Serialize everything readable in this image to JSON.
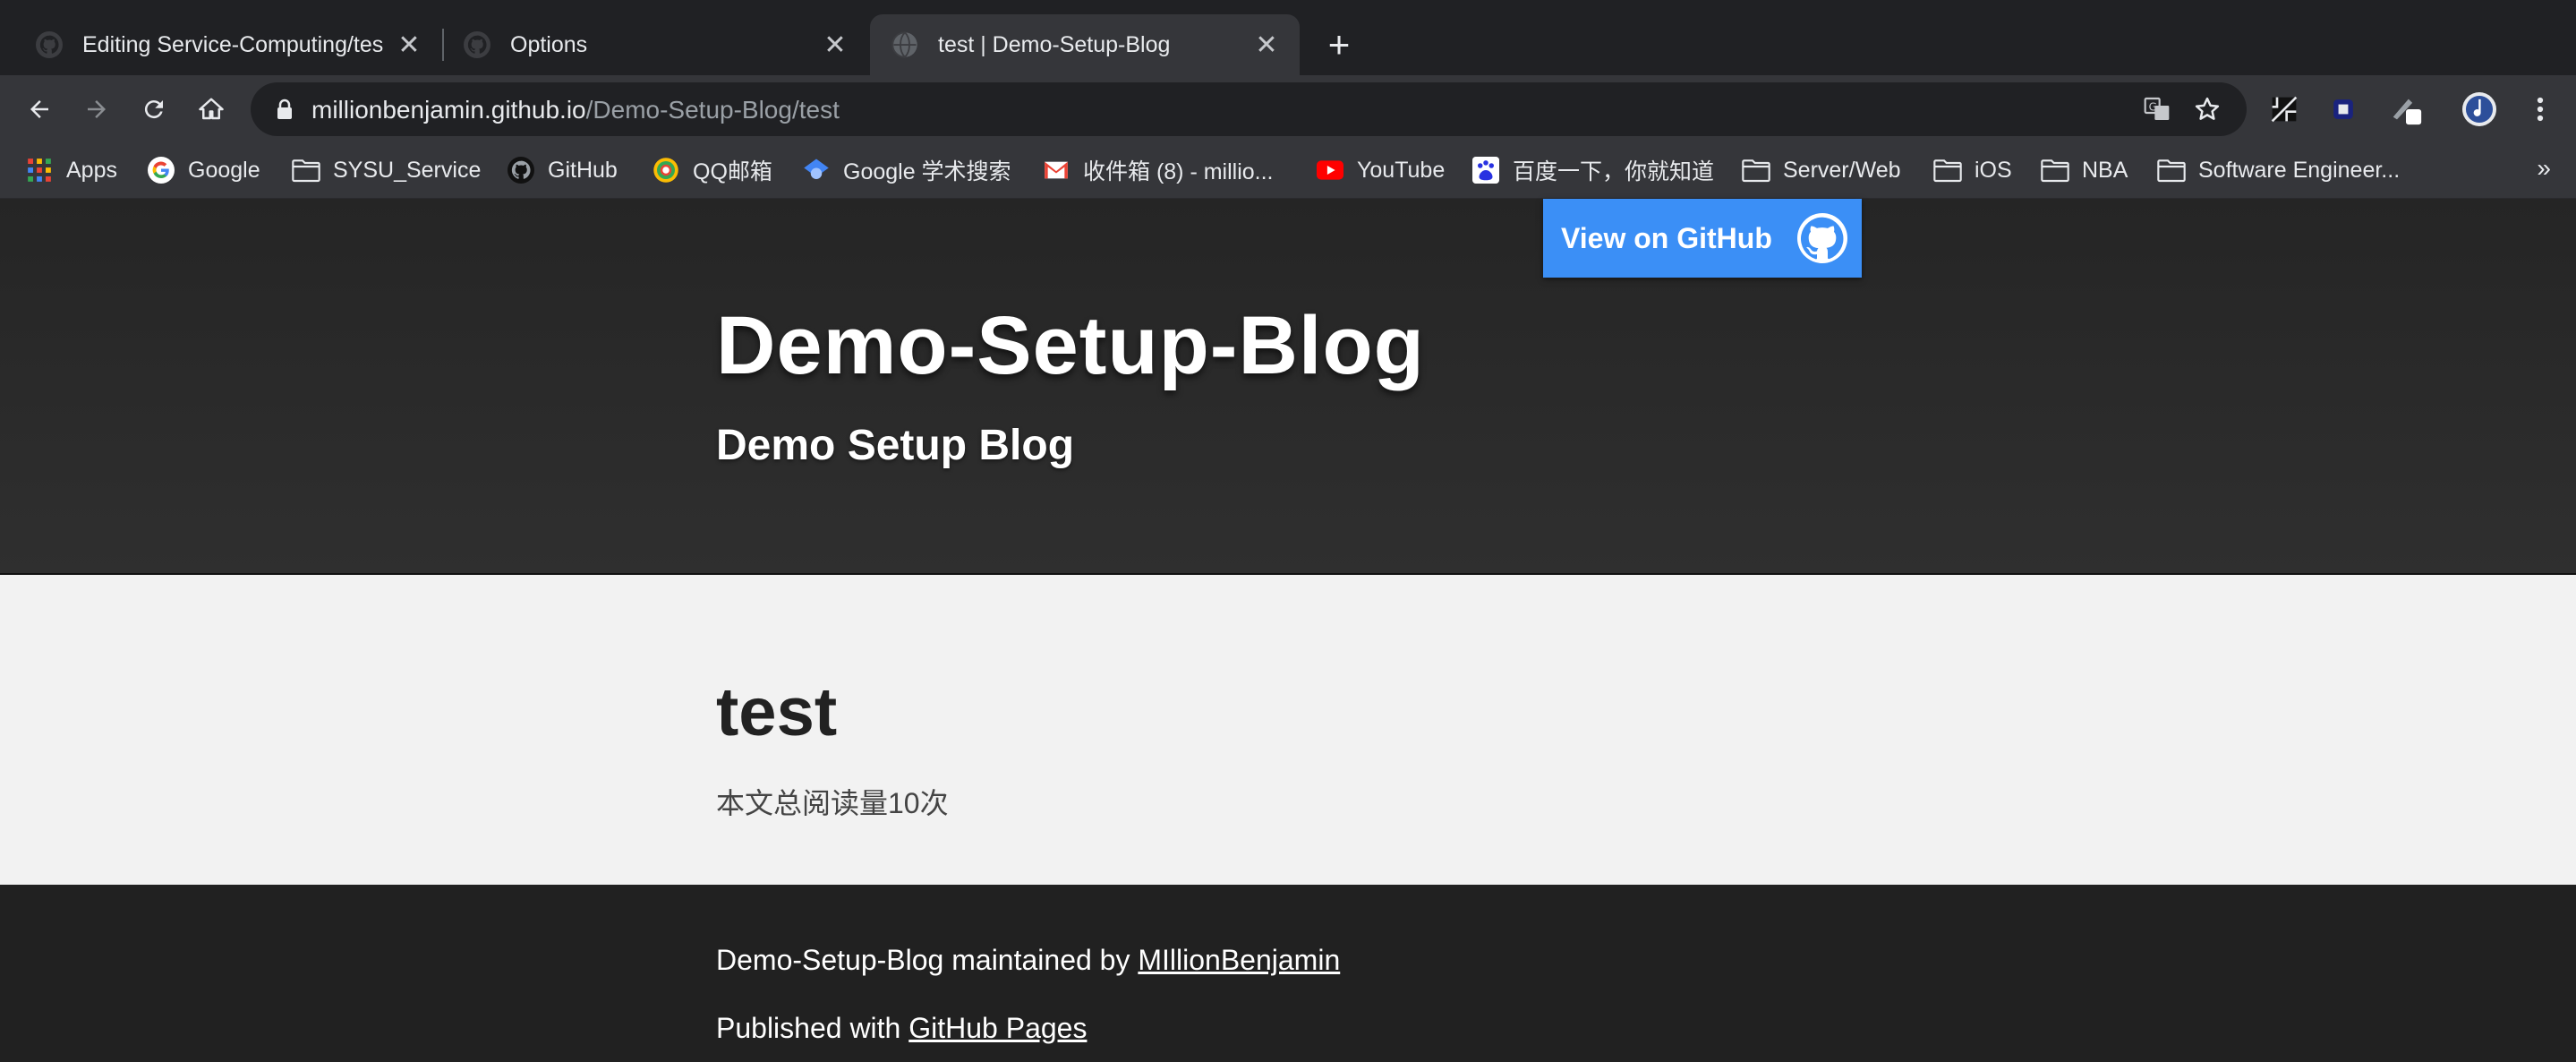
{
  "browser": {
    "tabs": [
      {
        "title": "Editing Service-Computing/tes",
        "icon": "github-icon",
        "active": false
      },
      {
        "title": "Options",
        "icon": "github-icon",
        "active": false
      },
      {
        "title": "test | Demo-Setup-Blog",
        "icon": "globe-icon",
        "active": true
      }
    ],
    "new_tab_label": "+",
    "close_glyph": "✕",
    "url_domain": "millionbenjamin.github.io",
    "url_path": "/Demo-Setup-Blog/test"
  },
  "bookmarks": [
    {
      "label": "Apps",
      "icon": "apps-grid-icon"
    },
    {
      "label": "Google",
      "icon": "google-icon"
    },
    {
      "label": "SYSU_Service",
      "icon": "folder-icon"
    },
    {
      "label": "GitHub",
      "icon": "github-icon"
    },
    {
      "label": "QQ邮箱",
      "icon": "qq-mail-icon"
    },
    {
      "label": "Google 学术搜索",
      "icon": "scholar-icon"
    },
    {
      "label": "收件箱 (8) - millio...",
      "icon": "gmail-icon"
    },
    {
      "label": "YouTube",
      "icon": "youtube-icon"
    },
    {
      "label": "百度一下，你就知道",
      "icon": "baidu-icon"
    },
    {
      "label": "Server/Web",
      "icon": "folder-icon"
    },
    {
      "label": "iOS",
      "icon": "folder-icon"
    },
    {
      "label": "NBA",
      "icon": "folder-icon"
    },
    {
      "label": "Software Engineer...",
      "icon": "folder-icon"
    }
  ],
  "bookmarks_more": "»",
  "header": {
    "github_button": "View on GitHub",
    "site_title": "Demo-Setup-Blog",
    "site_description": "Demo Setup Blog"
  },
  "post": {
    "title": "test",
    "read_count": "本文总阅读量10次"
  },
  "footer": {
    "maintained_prefix": "Demo-Setup-Blog maintained by ",
    "maintainer": "MIllionBenjamin",
    "published_prefix": "Published with ",
    "published_link": "GitHub Pages"
  },
  "colors": {
    "github_button": "#3b8ff6",
    "header_bg": "#2a2a2a",
    "main_bg": "#f2f2f2",
    "footer_bg": "#212121"
  }
}
